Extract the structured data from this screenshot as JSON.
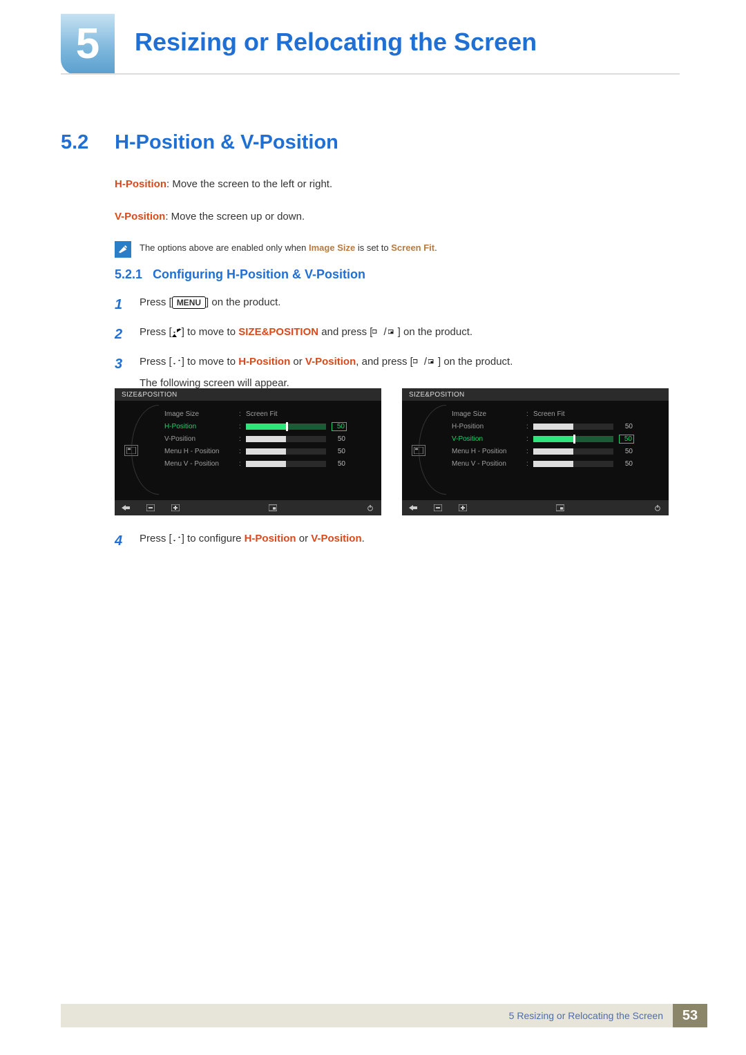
{
  "chapter": {
    "number": "5",
    "title": "Resizing or Relocating the Screen"
  },
  "section": {
    "number": "5.2",
    "title": "H-Position & V-Position"
  },
  "definitions": {
    "hpos_term": "H-Position",
    "hpos_text": ": Move the screen to the left or right.",
    "vpos_term": "V-Position",
    "vpos_text": ": Move the screen up or down.",
    "note_pre": "The options above are enabled only when ",
    "note_key1": "Image Size",
    "note_mid": " is set to ",
    "note_key2": "Screen Fit",
    "note_post": "."
  },
  "subsection": {
    "number": "5.2.1",
    "title": "Configuring H-Position & V-Position"
  },
  "steps": {
    "s1": {
      "n": "1",
      "pre": "Press [",
      "menu": "MENU",
      "post": "] on the product."
    },
    "s2": {
      "n": "2",
      "t1": "Press [",
      "t2": "] to move to ",
      "kw": "SIZE&POSITION",
      "t3": " and press [",
      "t4": "] on the product."
    },
    "s3": {
      "n": "3",
      "t1": "Press [",
      "t2": "] to move to ",
      "kw1": "H-Position",
      "or": " or ",
      "kw2": "V-Position",
      "t3": ", and press [",
      "t4": "] on the product.",
      "line2": "The following screen will appear."
    },
    "s4": {
      "n": "4",
      "t1": "Press [",
      "t2": "] to configure ",
      "kw1": "H-Position",
      "or": " or ",
      "kw2": "V-Position",
      "t3": "."
    }
  },
  "osd": {
    "header": "SIZE&POSITION",
    "items": [
      {
        "label": "Image Size",
        "text": "Screen Fit"
      },
      {
        "label": "H-Position",
        "value": 50
      },
      {
        "label": "V-Position",
        "value": 50
      },
      {
        "label": "Menu H - Position",
        "value": 50
      },
      {
        "label": "Menu V - Position",
        "value": 50
      }
    ],
    "left_active_label": "H-Position",
    "right_active_label": "V-Position"
  },
  "footer": {
    "chapter_num": "5",
    "chapter_title": "Resizing or Relocating the Screen",
    "page": "53"
  }
}
